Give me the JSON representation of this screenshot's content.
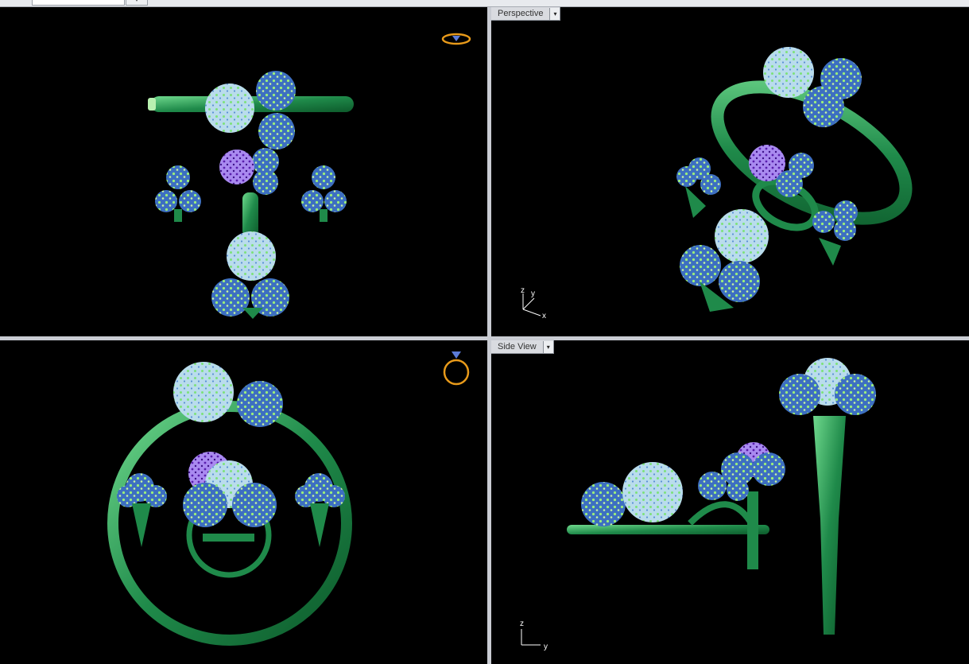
{
  "tabs": {
    "active_label": "",
    "add_symbol": "▾"
  },
  "viewports": {
    "top": {
      "label": ""
    },
    "perspective": {
      "label": "Perspective",
      "dropdown": "▾"
    },
    "front": {
      "label": ""
    },
    "side": {
      "label": "Side View",
      "dropdown": "▾"
    }
  },
  "axes": {
    "perspective": {
      "z": "z",
      "y": "y",
      "x": "x"
    },
    "side": {
      "z": "z",
      "y": "y"
    }
  },
  "colors": {
    "background": "#000000",
    "metal": "#1f8a4a",
    "metal_light": "#7ddf9a",
    "stone_pave": "#3d6fc1",
    "stone_center": "#8a4fd8",
    "highlight": "#c8f7a0",
    "nav_icon": "#e89a1a"
  },
  "icons": [
    "ring-navigation-icon",
    "viewport-dropdown-icon"
  ]
}
